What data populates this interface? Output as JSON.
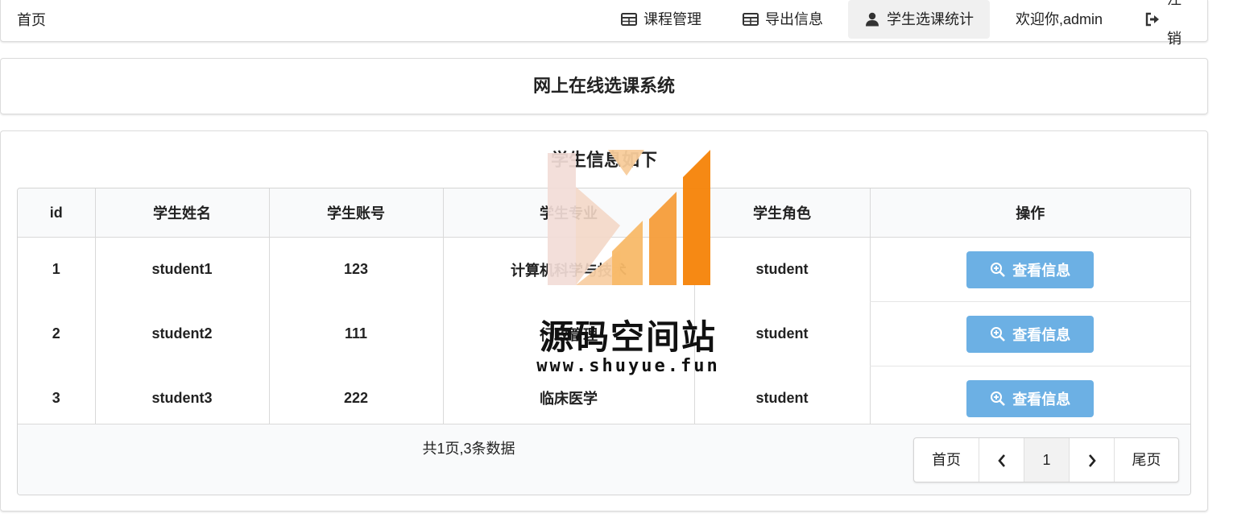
{
  "menu": {
    "home": "首页",
    "course_mgmt": "课程管理",
    "export_info": "导出信息",
    "student_stats": "学生选课统计",
    "welcome": "欢迎你,admin",
    "logout": "注销"
  },
  "system_title": "网上在线选课系统",
  "section_heading": "学生信息如下",
  "table": {
    "headers": [
      "id",
      "学生姓名",
      "学生账号",
      "学生专业",
      "学生角色",
      "操作"
    ],
    "rows": [
      {
        "id": "1",
        "name": "student1",
        "account": "123",
        "major": "计算机科学与技术",
        "role": "student",
        "action": "查看信息"
      },
      {
        "id": "2",
        "name": "student2",
        "account": "111",
        "major": "行政管理",
        "role": "student",
        "action": "查看信息"
      },
      {
        "id": "3",
        "name": "student3",
        "account": "222",
        "major": "临床医学",
        "role": "student",
        "action": "查看信息"
      }
    ]
  },
  "footer": {
    "total": "共1页,3条数据",
    "pager": {
      "first": "首页",
      "current": "1",
      "last": "尾页"
    }
  },
  "watermark": {
    "name": "源码空间站",
    "url": "www.shuyue.fun"
  },
  "colors": {
    "button": "#6cb0e4",
    "accent_orange": "#f6870f"
  }
}
